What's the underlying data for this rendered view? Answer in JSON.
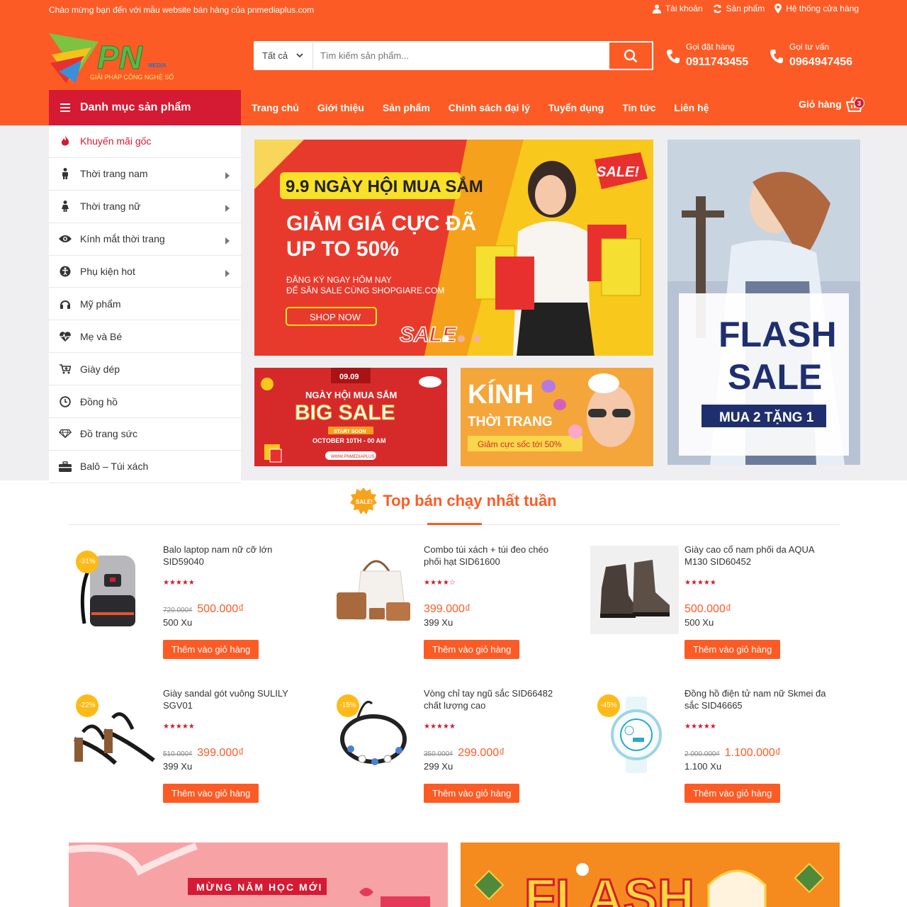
{
  "topbar": {
    "welcome": "Chào mừng bạn đến với mẫu website bán hàng của pnmediaplus.com",
    "account": "Tài khoản",
    "products": "Sản phẩm",
    "stores": "Hệ thống cửa hàng"
  },
  "logo": {
    "text": "PN",
    "tagline": "GIẢI PHÁP CÔNG NGHỆ SỐ",
    "sub": "MEDIA"
  },
  "search": {
    "category": "Tất cả",
    "placeholder": "Tìm kiếm sản phẩm..."
  },
  "hotlines": [
    {
      "label": "Gọi đặt hàng",
      "number": "0911743455"
    },
    {
      "label": "Gọi tư vấn",
      "number": "0964947456"
    }
  ],
  "nav": {
    "category_title": "Danh mục sản phẩm",
    "menu": [
      "Trang chủ",
      "Giới thiệu",
      "Sản phẩm",
      "Chính sách đại lý",
      "Tuyển dụng",
      "Tin tức",
      "Liên hệ"
    ],
    "cart_label": "Giỏ hàng",
    "cart_count": "3"
  },
  "sidebar": {
    "items": [
      {
        "label": "Khuyến mãi gốc",
        "icon": "fire-icon",
        "arrow": false,
        "color": "#d51a33"
      },
      {
        "label": "Thời trang nam",
        "icon": "male-icon",
        "arrow": true
      },
      {
        "label": "Thời trang nữ",
        "icon": "female-icon",
        "arrow": true
      },
      {
        "label": "Kính mắt thời trang",
        "icon": "eye-icon",
        "arrow": true
      },
      {
        "label": "Phụ kiện hot",
        "icon": "accessibility-icon",
        "arrow": true
      },
      {
        "label": "Mỹ phẩm",
        "icon": "headphones-icon",
        "arrow": false
      },
      {
        "label": "Mẹ và Bé",
        "icon": "heartbeat-icon",
        "arrow": false
      },
      {
        "label": "Giày dép",
        "icon": "cart-plus-icon",
        "arrow": false
      },
      {
        "label": "Đồng hồ",
        "icon": "clock-icon",
        "arrow": false
      },
      {
        "label": "Đồ trang sức",
        "icon": "diamond-icon",
        "arrow": false
      },
      {
        "label": "Balô – Túi xách",
        "icon": "briefcase-icon",
        "arrow": false
      }
    ]
  },
  "banners": {
    "main": {
      "line1": "9.9 NGÀY HỘI MUA SẮM",
      "line2": "GIẢM GIÁ CỰC ĐÃ",
      "line3": "UP TO 50%",
      "line4": "ĐĂNG KÝ NGAY HÔM NAY",
      "line5": "ĐỂ SĂN SALE CÙNG SHOPGIARE.COM",
      "cta": "SHOP NOW",
      "sale": "SALE",
      "sticker": "SALE!"
    },
    "bigsale": {
      "date": "09.09",
      "line1": "NGÀY HỘI MUA SẮM",
      "line2": "BIG SALE",
      "line3": "START SOON",
      "line4": "OCTOBER 10TH - 00 AM",
      "url": "WWW.PNMEDIAPLUS.COM"
    },
    "kinh": {
      "line1": "KÍNH",
      "line2": "THỜI TRANG",
      "line3": "Giảm cực sốc tới 50%"
    },
    "flash": {
      "line1": "FLASH",
      "line2": "SALE",
      "line3": "MUA 2 TẶNG 1"
    }
  },
  "section": {
    "title": "Top bán chạy nhất tuần",
    "badge": "SALE!"
  },
  "products": [
    {
      "name": "Balo laptop nam nữ cỡ lớn SID59040",
      "discount": "-31%",
      "stars": "★★★★★",
      "old": "720.000₫",
      "price": "500.000₫",
      "xu": "500 Xu",
      "cta": "Thêm vào giỏ hàng",
      "image": "backpack-image"
    },
    {
      "name": "Combo túi xách + túi đeo chéo phối hạt SID61600",
      "discount": "",
      "stars": "★★★★☆",
      "old": "",
      "price": "399.000₫",
      "xu": "399 Xu",
      "cta": "Thêm vào giỏ hàng",
      "image": "handbag-image"
    },
    {
      "name": "Giày cao cổ nam phối da AQUA M130 SID60452",
      "discount": "",
      "stars": "★★★★★",
      "old": "",
      "price": "500.000₫",
      "xu": "500 Xu",
      "cta": "Thêm vào giỏ hàng",
      "image": "boots-image"
    },
    {
      "name": "Giày sandal gót vuông SULILY SGV01",
      "discount": "-22%",
      "stars": "★★★★★",
      "old": "510.000₫",
      "price": "399.000₫",
      "xu": "399 Xu",
      "cta": "Thêm vào giỏ hàng",
      "image": "sandal-image"
    },
    {
      "name": "Vòng chỉ tay ngũ sắc SID66482 chất lượng cao",
      "discount": "-15%",
      "stars": "★★★★★",
      "old": "350.000₫",
      "price": "299.000₫",
      "xu": "299 Xu",
      "cta": "Thêm vào giỏ hàng",
      "image": "bracelet-image"
    },
    {
      "name": "Đồng hồ điện tử nam nữ Skmei đa sắc SID46665",
      "discount": "-45%",
      "stars": "★★★★★",
      "old": "2.000.000₫",
      "price": "1.100.000₫",
      "xu": "1.100 Xu",
      "cta": "Thêm vào giỏ hàng",
      "image": "watch-image"
    }
  ],
  "promo": {
    "left": "MỪNG NĂM HỌC MỚI",
    "right": "FLASH"
  }
}
